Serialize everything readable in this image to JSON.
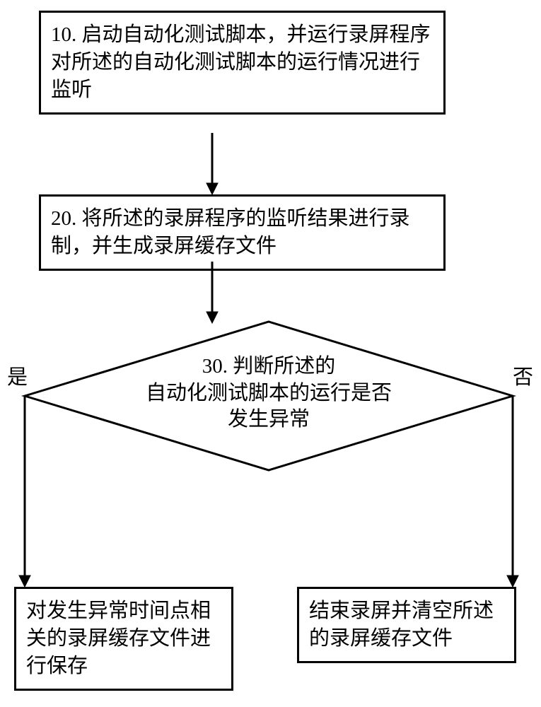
{
  "steps": {
    "s10": "10. 启动自动化测试脚本，并运行录屏程序对所述的自动化测试脚本的运行情况进行监听",
    "s20": "20. 将所述的录屏程序的监听结果进行录制，并生成录屏缓存文件",
    "s30_l1": "30. 判断所述的",
    "s30_l2": "自动化测试脚本的运行是否",
    "s30_l3": "发生异常",
    "yes_outcome": "对发生异常时间点相关的录屏缓存文件进行保存",
    "no_outcome": "结束录屏并清空所述的录屏缓存文件"
  },
  "labels": {
    "yes": "是",
    "no": "否"
  },
  "chart_data": {
    "type": "flowchart",
    "nodes": [
      {
        "id": "10",
        "kind": "process",
        "text": "启动自动化测试脚本，并运行录屏程序对所述的自动化测试脚本的运行情况进行监听"
      },
      {
        "id": "20",
        "kind": "process",
        "text": "将所述的录屏程序的监听结果进行录制，并生成录屏缓存文件"
      },
      {
        "id": "30",
        "kind": "decision",
        "text": "判断所述的自动化测试脚本的运行是否发生异常"
      },
      {
        "id": "yes",
        "kind": "terminal",
        "text": "对发生异常时间点相关的录屏缓存文件进行保存"
      },
      {
        "id": "no",
        "kind": "terminal",
        "text": "结束录屏并清空所述的录屏缓存文件"
      }
    ],
    "edges": [
      {
        "from": "10",
        "to": "20"
      },
      {
        "from": "20",
        "to": "30"
      },
      {
        "from": "30",
        "to": "yes",
        "label": "是"
      },
      {
        "from": "30",
        "to": "no",
        "label": "否"
      }
    ]
  }
}
